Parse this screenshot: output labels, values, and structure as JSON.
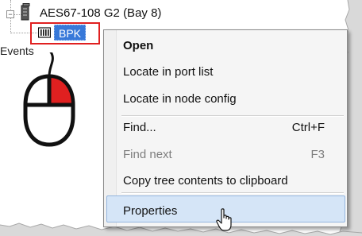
{
  "tree": {
    "expander_symbol": "−",
    "device_node_label": "AES67-108 G2 (Bay  8)",
    "selected_node_label": "BPK"
  },
  "panel": {
    "events_label": "Events"
  },
  "context_menu": {
    "items": [
      {
        "label": "Open",
        "shortcut": "",
        "bold": true,
        "disabled": false
      },
      {
        "label": "Locate in port list",
        "shortcut": "",
        "bold": false,
        "disabled": false
      },
      {
        "label": "Locate in node config",
        "shortcut": "",
        "bold": false,
        "disabled": false
      },
      {
        "label": "Find...",
        "shortcut": "Ctrl+F",
        "bold": false,
        "disabled": false
      },
      {
        "label": "Find next",
        "shortcut": "F3",
        "bold": false,
        "disabled": true
      },
      {
        "label": "Copy tree contents to clipboard",
        "shortcut": "",
        "bold": false,
        "disabled": false
      },
      {
        "label": "Properties",
        "shortcut": "",
        "bold": false,
        "disabled": false,
        "hovered": true
      }
    ]
  },
  "colors": {
    "highlight_border": "#e02020",
    "selection_bg": "#3879d9",
    "hover_bg": "#d5e5f7",
    "mouse_button": "#e02020"
  },
  "icons": [
    "device-rack-icon",
    "module-card-icon",
    "mouse-right-click-icon",
    "pointer-cursor-icon"
  ]
}
